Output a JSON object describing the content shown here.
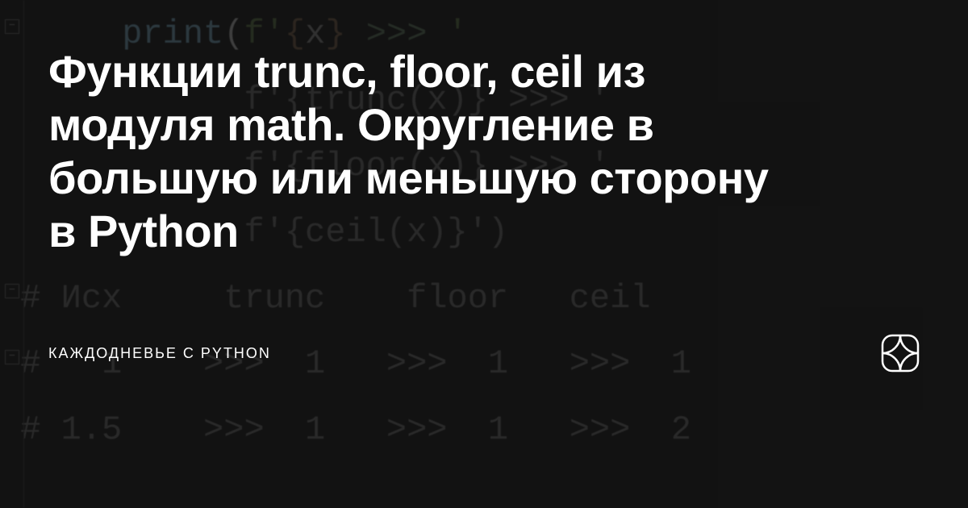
{
  "title": "Функции trunc, floor, ceil из модуля math. Округление в большую или меньшую сторону в Python",
  "source": "КАЖДОДНЕВЬЕ С PYTHON",
  "code": {
    "line1_prefix": "      ",
    "line1_fn": "print",
    "line1_paren_open": "(",
    "line1_fstr_start": "f'",
    "line1_brace_open": "{",
    "line1_var": "x",
    "line1_brace_close": "}",
    "line1_str_mid": " ",
    "line1_op": ">>>",
    "line1_str_end": " '",
    "line2": "            f'{trunc(x)} >>> '",
    "line3": "            f'{floor(x)} >>> '",
    "line4": "            f'{ceil(x)}')",
    "line5": " # Исх     trunc    floor   ceil",
    "line6": " #   1    >>>  1   >>>  1   >>>  1",
    "line7": " # 1.5    >>>  1   >>>  1   >>>  2"
  }
}
